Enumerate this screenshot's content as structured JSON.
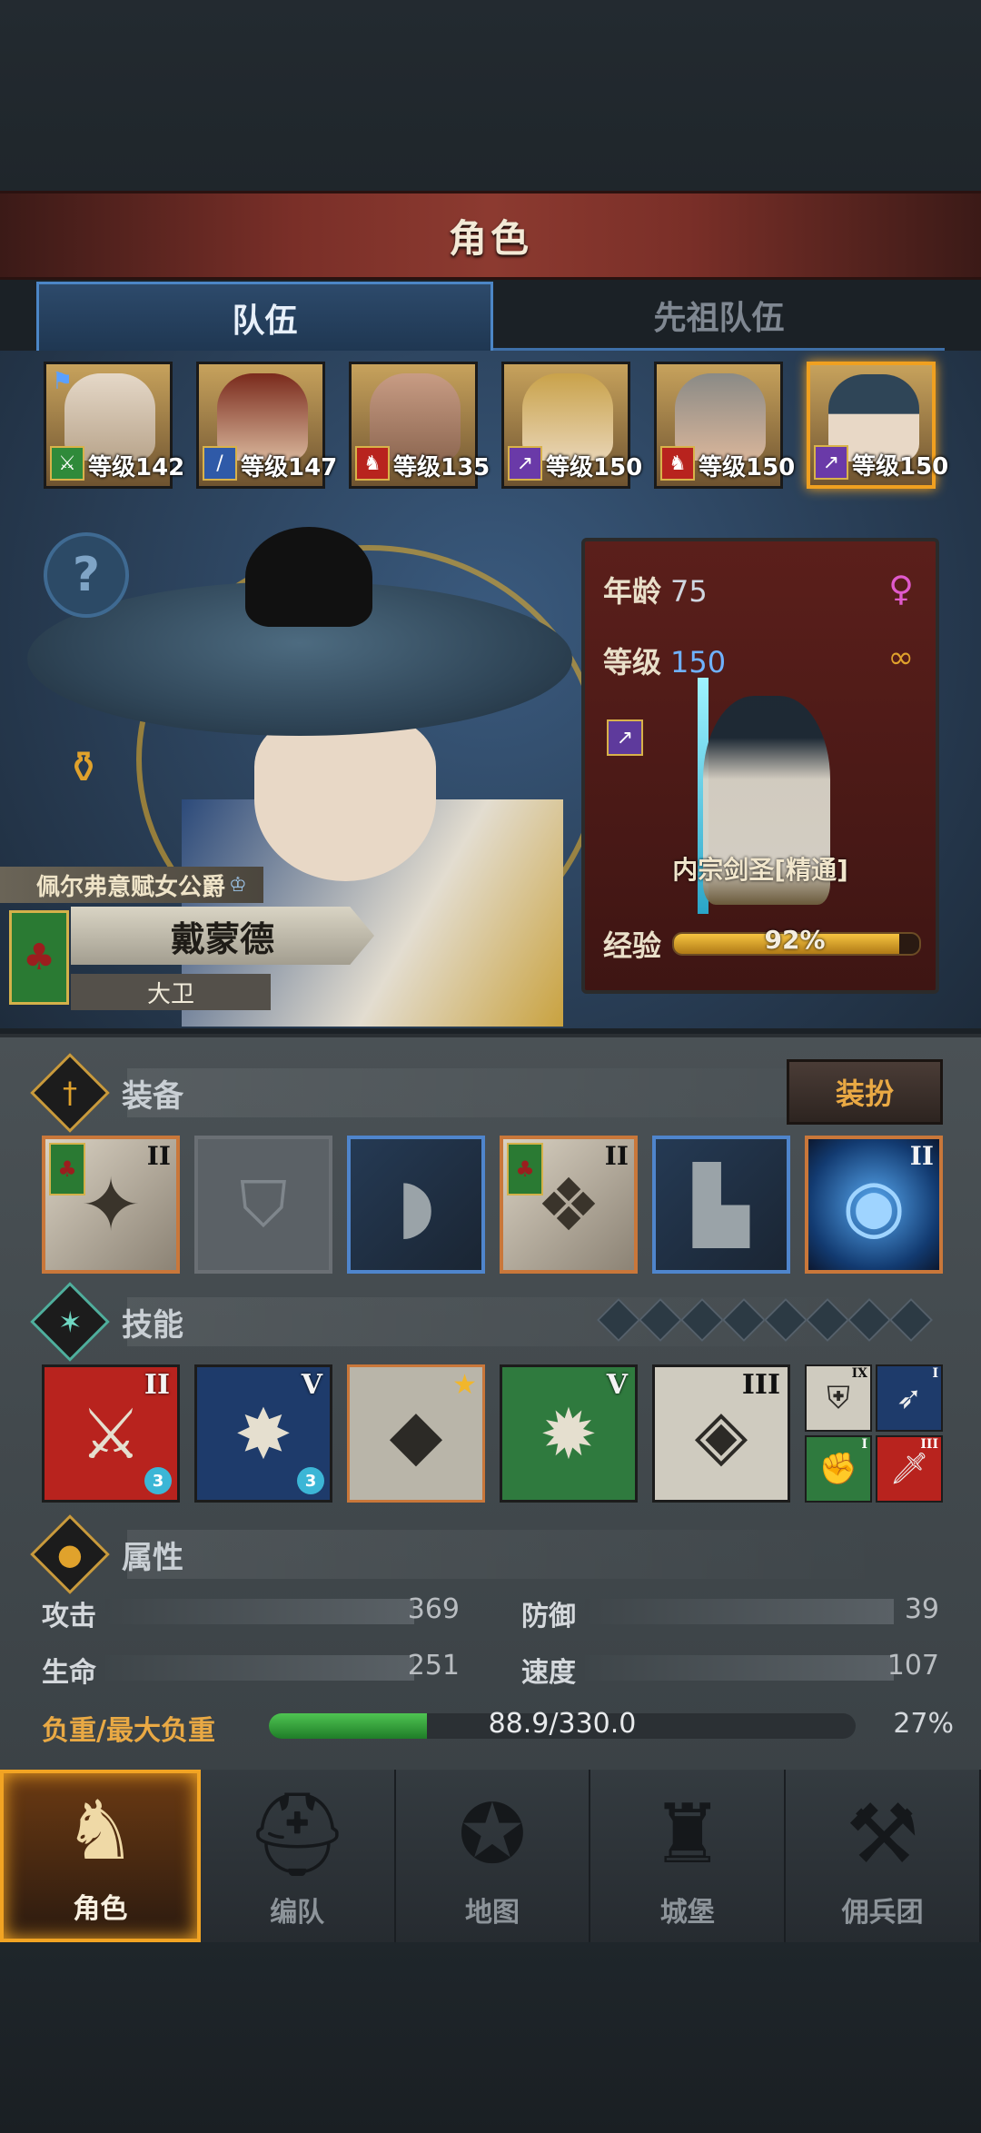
{
  "header": {
    "title": "角色"
  },
  "tabs": [
    {
      "label": "队伍",
      "active": true
    },
    {
      "label": "先祖队伍",
      "active": false
    }
  ],
  "party": [
    {
      "level": "等级142",
      "class_icon": "crossed-swords-icon",
      "class_color": "#2f8a3a"
    },
    {
      "level": "等级147",
      "class_icon": "sword-icon",
      "class_color": "#2f5aa8"
    },
    {
      "level": "等级135",
      "class_icon": "horse-icon",
      "class_color": "#b8231e"
    },
    {
      "level": "等级150",
      "class_icon": "staff-icon",
      "class_color": "#6a3aa8"
    },
    {
      "level": "等级150",
      "class_icon": "horse-icon",
      "class_color": "#b8231e"
    },
    {
      "level": "等级150",
      "class_icon": "staff-icon",
      "class_color": "#6a3aa8"
    }
  ],
  "character": {
    "title": "佩尔弗意赋女公爵",
    "name": "戴蒙德",
    "sub_name": "大卫",
    "age_label": "年龄",
    "age": "75",
    "level_label": "等级",
    "level": "150",
    "job": "内宗剑圣[精通]",
    "exp_label": "经验",
    "exp_percent": "92%",
    "exp_fraction": 0.92
  },
  "equipment": {
    "title": "装备",
    "dress_button": "装扮",
    "slots": [
      {
        "name": "weapon",
        "tier": "II",
        "style": "orange",
        "icon": "shuriken-icon",
        "flag": true
      },
      {
        "name": "shield",
        "tier": "",
        "style": "empty",
        "icon": "shield-icon",
        "flag": false
      },
      {
        "name": "hood",
        "tier": "",
        "style": "blue",
        "icon": "hood-icon",
        "flag": false
      },
      {
        "name": "armor",
        "tier": "II",
        "style": "orange",
        "icon": "armor-icon",
        "flag": true
      },
      {
        "name": "boots",
        "tier": "",
        "style": "blue",
        "icon": "boots-icon",
        "flag": false
      },
      {
        "name": "orb",
        "tier": "II",
        "style": "orange-orb",
        "icon": "orb-icon",
        "flag": false
      }
    ]
  },
  "skills": {
    "title": "技能",
    "items": [
      {
        "tier": "II",
        "color": "red",
        "icon": "broken-sword-icon",
        "gem": "3"
      },
      {
        "tier": "V",
        "color": "navy",
        "icon": "burst-figure-icon",
        "gem": "3"
      },
      {
        "tier": "",
        "color": "grey",
        "icon": "crystal-sword-icon",
        "star": true
      },
      {
        "tier": "V",
        "color": "green",
        "icon": "crystal-burst-icon"
      },
      {
        "tier": "III",
        "color": "lite",
        "icon": "crystal-hand-icon"
      }
    ],
    "mini": [
      {
        "tier": "IX",
        "color": "#cfcbbf",
        "icon": "shield-cross-icon"
      },
      {
        "tier": "I",
        "color": "#1e3b6b",
        "icon": "wing-icon"
      },
      {
        "tier": "I",
        "color": "#2f7a3e",
        "icon": "fist-icon"
      },
      {
        "tier": "III",
        "color": "#b8231e",
        "icon": "dagger-icon"
      }
    ]
  },
  "attributes": {
    "title": "属性",
    "attack_label": "攻击",
    "attack": "369",
    "defense_label": "防御",
    "defense": "39",
    "hp_label": "生命",
    "hp": "251",
    "speed_label": "速度",
    "speed": "107",
    "load_label": "负重/最大负重",
    "load_value": "88.9/330.0",
    "load_percent": "27%",
    "load_fraction": 0.27
  },
  "nav": [
    {
      "label": "角色",
      "icon": "knight-icon",
      "active": true
    },
    {
      "label": "编队",
      "icon": "helmet-icon",
      "active": false
    },
    {
      "label": "地图",
      "icon": "compass-map-icon",
      "active": false
    },
    {
      "label": "城堡",
      "icon": "castle-icon",
      "active": false
    },
    {
      "label": "佣兵团",
      "icon": "mercenary-icon",
      "active": false
    }
  ]
}
